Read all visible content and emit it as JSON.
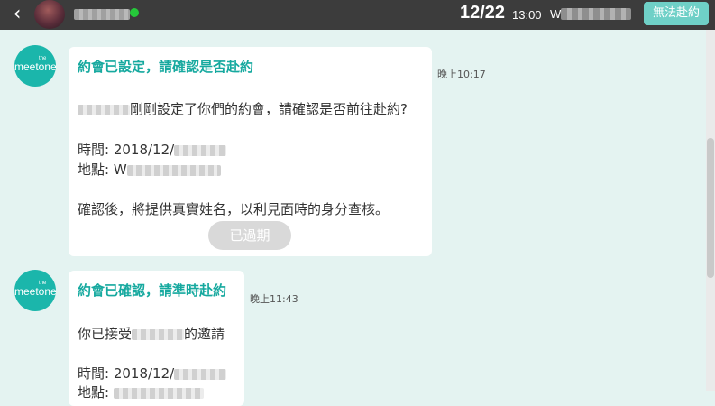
{
  "header": {
    "back_icon": "‹",
    "date": "12/22",
    "time": "13:00",
    "place_initial": "W",
    "cannot_attend_label": "無法赴約"
  },
  "brand": {
    "logo_small": "the",
    "logo_big": "meetone"
  },
  "messages": [
    {
      "title": "約會已設定，請確認是否赴約",
      "line1_suffix": "剛剛設定了你們的約會，請確認是否前往赴約?",
      "time_prefix": "時間: 2018/12/",
      "place_prefix": "地點: ",
      "place_initial": "W",
      "note": "確認後，將提供真實姓名，以利見面時的身分查核。",
      "button_label": "已過期",
      "timestamp": "晚上10:17"
    },
    {
      "title": "約會已確認，請準時赴約",
      "line1_prefix": "你已接受",
      "line1_suffix": "的邀請",
      "time_prefix": "時間: 2018/12/",
      "place_prefix": "地點: ",
      "timestamp": "晚上11:43"
    }
  ],
  "colors": {
    "accent": "#16a99f",
    "header_bg": "#3c3c3c",
    "page_bg": "#e4f3f1",
    "online": "#25c93a"
  }
}
